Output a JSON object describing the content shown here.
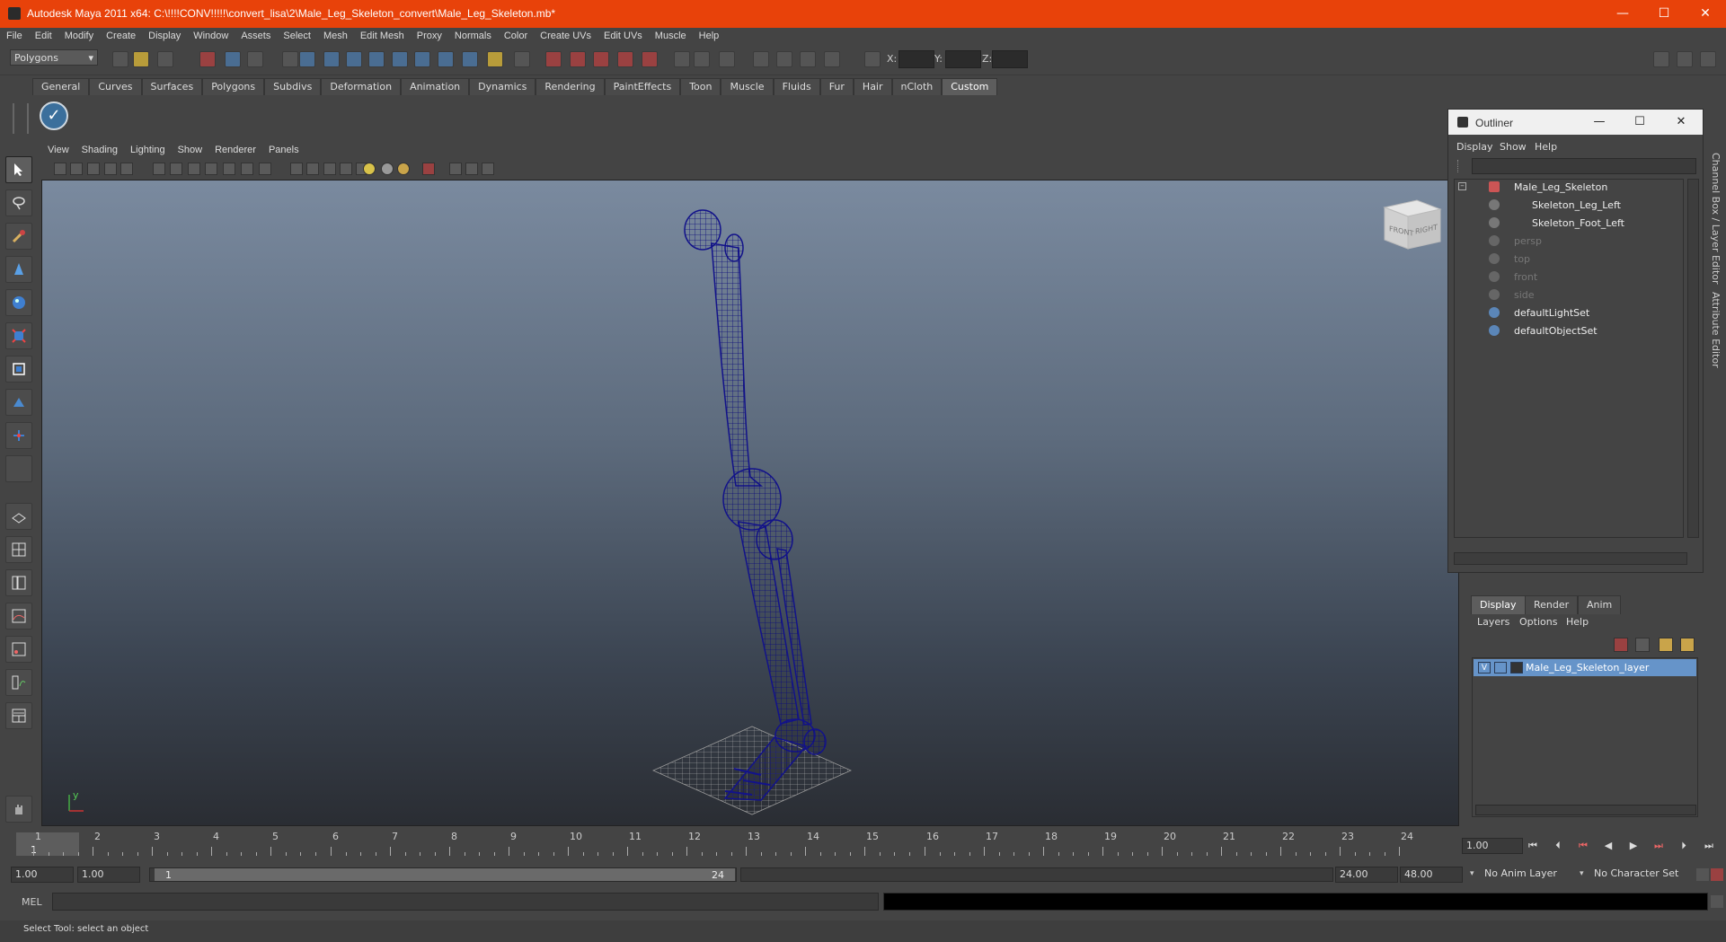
{
  "window": {
    "title": "Autodesk Maya 2011 x64: C:\\!!!!CONV!!!!!\\convert_lisa\\2\\Male_Leg_Skeleton_convert\\Male_Leg_Skeleton.mb*",
    "minimize": "—",
    "maximize": "☐",
    "close": "✕"
  },
  "menu": [
    "File",
    "Edit",
    "Modify",
    "Create",
    "Display",
    "Window",
    "Assets",
    "Select",
    "Mesh",
    "Edit Mesh",
    "Proxy",
    "Normals",
    "Color",
    "Create UVs",
    "Edit UVs",
    "Muscle",
    "Help"
  ],
  "statusline": {
    "mode": "Polygons",
    "x_label": "X:",
    "y_label": "Y:",
    "z_label": "Z:"
  },
  "shelf": {
    "tabs": [
      "General",
      "Curves",
      "Surfaces",
      "Polygons",
      "Subdivs",
      "Deformation",
      "Animation",
      "Dynamics",
      "Rendering",
      "PaintEffects",
      "Toon",
      "Muscle",
      "Fluids",
      "Fur",
      "Hair",
      "nCloth",
      "Custom"
    ],
    "active_tab": "Custom"
  },
  "viewport": {
    "menu": [
      "View",
      "Shading",
      "Lighting",
      "Show",
      "Renderer",
      "Panels"
    ],
    "viewcube_front": "FRONT",
    "viewcube_right": "RIGHT",
    "axis_y": "y",
    "axis_x": "x"
  },
  "outliner": {
    "title": "Outliner",
    "menu": [
      "Display",
      "Show",
      "Help"
    ],
    "items": [
      {
        "label": "Male_Leg_Skeleton",
        "dim": false
      },
      {
        "label": "Skeleton_Leg_Left",
        "dim": false
      },
      {
        "label": "Skeleton_Foot_Left",
        "dim": false
      },
      {
        "label": "persp",
        "dim": true
      },
      {
        "label": "top",
        "dim": true
      },
      {
        "label": "front",
        "dim": true
      },
      {
        "label": "side",
        "dim": true
      },
      {
        "label": "defaultLightSet",
        "dim": false
      },
      {
        "label": "defaultObjectSet",
        "dim": false
      }
    ]
  },
  "layer_editor": {
    "tabs": [
      "Display",
      "Render",
      "Anim"
    ],
    "active_tab": "Display",
    "menu": [
      "Layers",
      "Options",
      "Help"
    ],
    "layer_visible": "V",
    "layer_name": "Male_Leg_Skeleton_layer"
  },
  "side_tabs": {
    "channel_box": "Channel Box / Layer Editor",
    "attribute_editor": "Attribute Editor"
  },
  "timeslider": {
    "ticks": [
      "1",
      "2",
      "3",
      "4",
      "5",
      "6",
      "7",
      "8",
      "9",
      "10",
      "11",
      "12",
      "13",
      "14",
      "15",
      "16",
      "17",
      "18",
      "19",
      "20",
      "21",
      "22",
      "23",
      "24"
    ],
    "current_frame_marker": "1",
    "current_time": "1.00"
  },
  "range": {
    "start_time": "1.00",
    "playback_start": "1.00",
    "slider_start": "1",
    "slider_end": "24",
    "playback_end": "24.00",
    "end_time": "48.00",
    "anim_layer": "No Anim Layer",
    "character_set": "No Character Set"
  },
  "command": {
    "label": "MEL"
  },
  "status": {
    "help_text": "Select Tool: select an object"
  }
}
